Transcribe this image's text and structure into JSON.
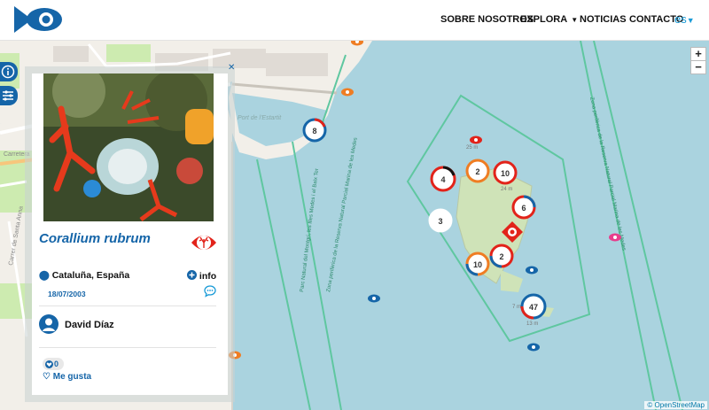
{
  "header": {
    "nav": [
      {
        "label": "SOBRE NOSOTROS"
      },
      {
        "label": "EXPLORA"
      },
      {
        "label": "NOTICIAS"
      },
      {
        "label": "CONTACTO"
      }
    ],
    "lang": "es"
  },
  "map": {
    "zoom_in": "+",
    "zoom_out": "−",
    "attribution": "© OpenStreetMap",
    "clusters": [
      {
        "count": "8"
      },
      {
        "count": "4"
      },
      {
        "count": "2"
      },
      {
        "count": "10"
      },
      {
        "count": "3"
      },
      {
        "count": "6"
      },
      {
        "count": "10"
      },
      {
        "count": "2"
      },
      {
        "count": "47"
      }
    ],
    "depth_labels": [
      "25 m",
      "24 m",
      "7 m",
      "13 m"
    ],
    "line_labels": [
      "Parc Natural del Montgrí, les Illes Medes i el Baix Ter",
      "Zona perifèrica de la Reserva Natural Parcial Marina de les Medes",
      "Zona perifèrica de la Reserva Natural Parcial Marina de les Medes"
    ],
    "street_labels": [
      "Port de l'Estartit",
      "Carretera",
      "Carrer de Santa Anna"
    ]
  },
  "panel": {
    "species": "Corallium rubrum",
    "location": "Cataluña, España",
    "info_label": "info",
    "date": "18/07/2003",
    "author": "David Díaz",
    "likes": "0",
    "like_label": "Me gusta"
  },
  "colors": {
    "brand": "#1565a8",
    "accent": "#1a9bd7",
    "sea": "#aad3df",
    "zone": "#5fc7a0",
    "marker_red": "#e2231a",
    "marker_orange": "#ef7d23",
    "marker_pink": "#e83e8c"
  }
}
